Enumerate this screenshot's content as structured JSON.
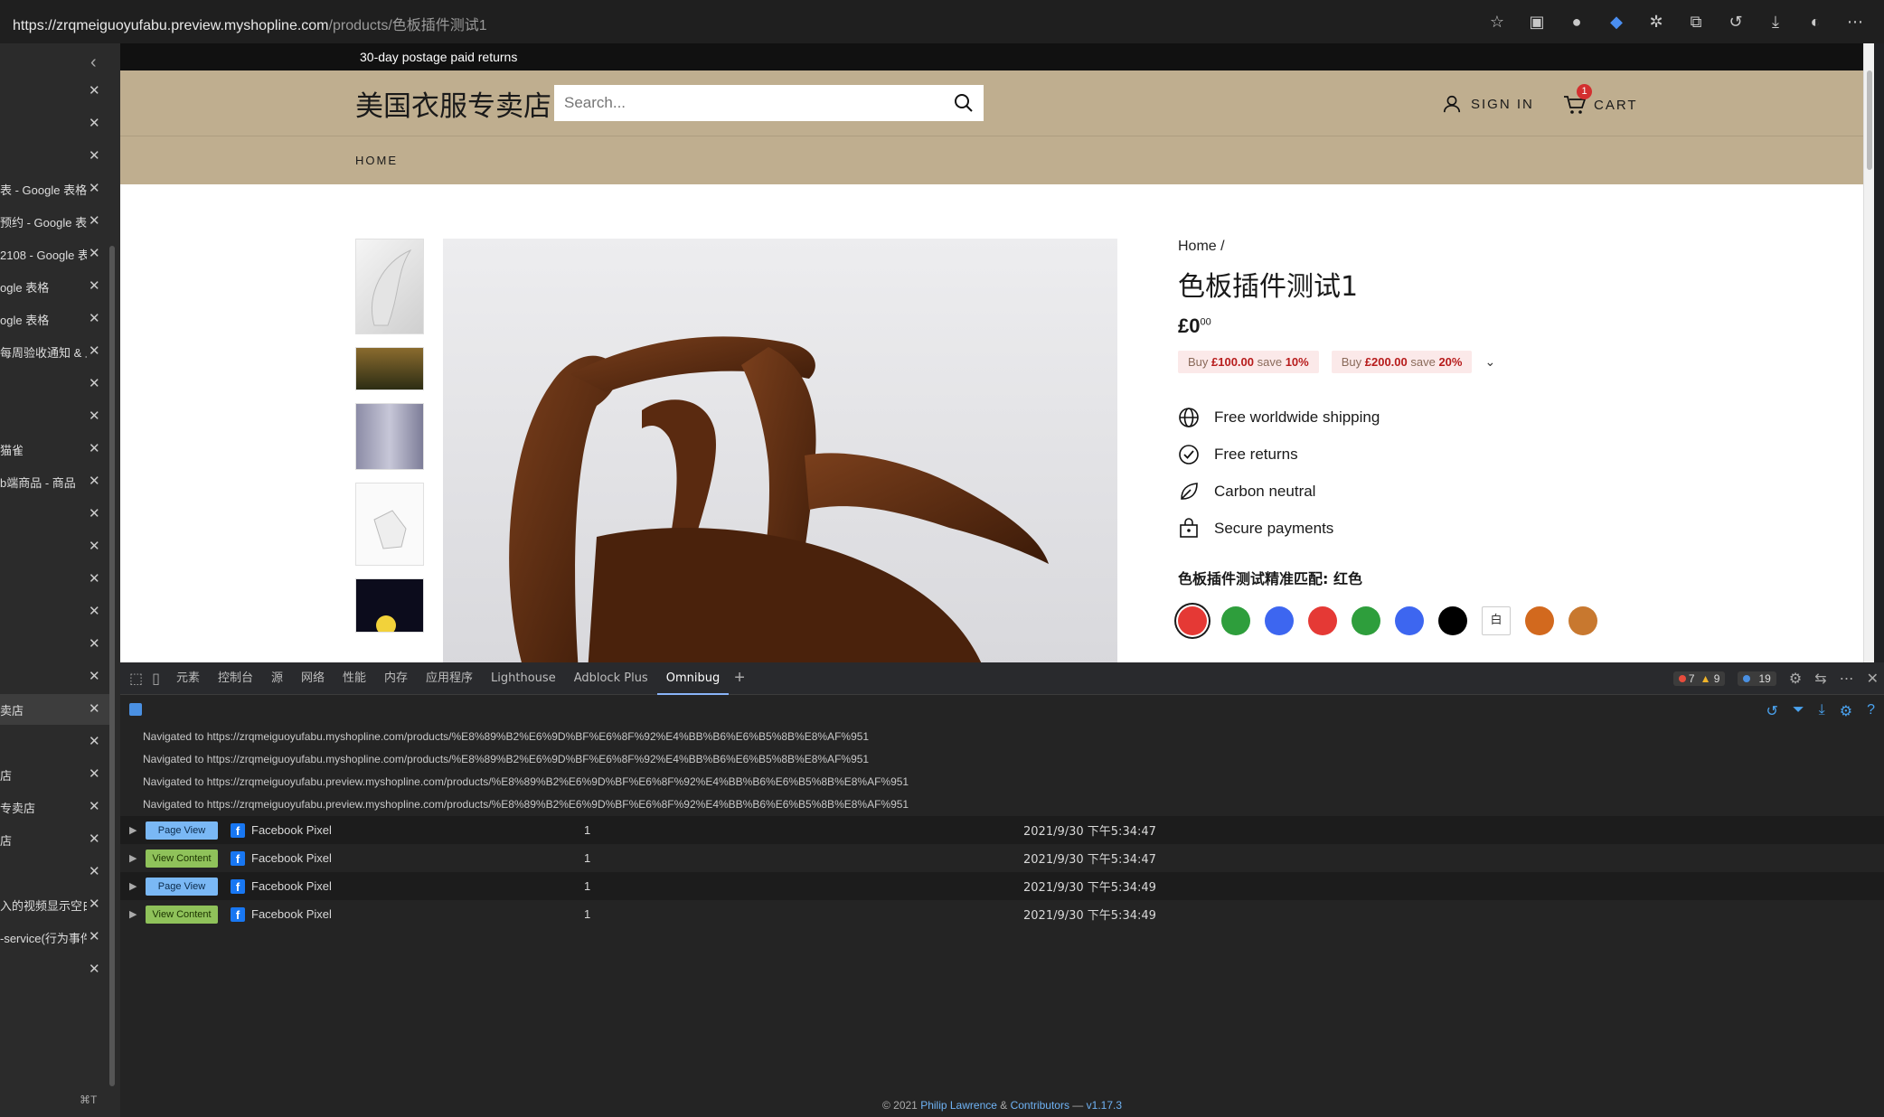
{
  "browser": {
    "url_host": "https://zrqmeiguoyufabu.preview.myshopline.com",
    "url_path": "/products/色板插件测试1"
  },
  "sidebar": {
    "tabs": [
      {
        "label": "",
        "active": false
      },
      {
        "label": "",
        "active": false
      },
      {
        "label": "",
        "active": false
      },
      {
        "label": "表 - Google 表格",
        "active": false
      },
      {
        "label": "预约 - Google 表",
        "active": false
      },
      {
        "label": "2108 - Google 表",
        "active": false
      },
      {
        "label": "ogle 表格",
        "active": false
      },
      {
        "label": "ogle 表格",
        "active": false
      },
      {
        "label": "每周验收通知 & 上",
        "active": false
      },
      {
        "label": "",
        "active": false
      },
      {
        "label": "",
        "active": false
      },
      {
        "label": "猫雀",
        "active": false
      },
      {
        "label": "b端商品 - 商品",
        "active": false
      },
      {
        "label": "",
        "active": false
      },
      {
        "label": "",
        "active": false
      },
      {
        "label": "",
        "active": false
      },
      {
        "label": "",
        "active": false
      },
      {
        "label": "",
        "active": false
      },
      {
        "label": "",
        "active": false
      },
      {
        "label": "卖店",
        "active": true
      },
      {
        "label": "",
        "active": false
      },
      {
        "label": "店",
        "active": false
      },
      {
        "label": "专卖店",
        "active": false
      },
      {
        "label": "店",
        "active": false
      },
      {
        "label": "",
        "active": false
      },
      {
        "label": "入的视频显示空白",
        "active": false
      },
      {
        "label": "-service(行为事件",
        "active": false
      },
      {
        "label": "",
        "active": false
      }
    ],
    "shortcut": "⌘T"
  },
  "site": {
    "announcement": "30-day postage paid returns",
    "logo": "美国衣服专卖店",
    "search_placeholder": "Search...",
    "sign_in": "SIGN IN",
    "cart": "CART",
    "cart_count": "1",
    "nav_home": "HOME",
    "breadcrumb": "Home /",
    "product_title": "色板插件测试1",
    "price_main": "£0",
    "price_cents": "00",
    "offers": [
      {
        "pre": "Buy ",
        "amount": "£100.00",
        "mid": " save ",
        "pct": "10%"
      },
      {
        "pre": "Buy ",
        "amount": "£200.00",
        "mid": " save ",
        "pct": "20%"
      }
    ],
    "perks": [
      {
        "icon": "globe-icon",
        "label": "Free worldwide shipping"
      },
      {
        "icon": "check-circle-icon",
        "label": "Free returns"
      },
      {
        "icon": "leaf-icon",
        "label": "Carbon neutral"
      },
      {
        "icon": "lock-bag-icon",
        "label": "Secure payments"
      }
    ],
    "variant_label": "色板插件测试精准匹配: 红色",
    "swatches": [
      {
        "color": "#e53935",
        "text": ""
      },
      {
        "color": "#2e9e3c",
        "text": ""
      },
      {
        "color": "#3d66f0",
        "text": ""
      },
      {
        "color": "#e53935",
        "text": ""
      },
      {
        "color": "#2e9e3c",
        "text": ""
      },
      {
        "color": "#3d66f0",
        "text": ""
      },
      {
        "color": "#000000",
        "text": ""
      },
      {
        "color": "#ffffff",
        "text": "白"
      },
      {
        "color": "#d2691e",
        "text": ""
      },
      {
        "color": "#c8782f",
        "text": ""
      }
    ]
  },
  "devtools": {
    "tabs": [
      "元素",
      "控制台",
      "源",
      "网络",
      "性能",
      "内存",
      "应用程序",
      "Lighthouse",
      "Adblock Plus",
      "Omnibug"
    ],
    "active_tab": "Omnibug",
    "errors": "7",
    "warnings": "9",
    "info": "19",
    "nav_lines": [
      "Navigated to https://zrqmeiguoyufabu.myshopline.com/products/%E8%89%B2%E6%9D%BF%E6%8F%92%E4%BB%B6%E6%B5%8B%E8%AF%951",
      "Navigated to https://zrqmeiguoyufabu.myshopline.com/products/%E8%89%B2%E6%9D%BF%E6%8F%92%E4%BB%B6%E6%B5%8B%E8%AF%951",
      "Navigated to https://zrqmeiguoyufabu.preview.myshopline.com/products/%E8%89%B2%E6%9D%BF%E6%8F%92%E4%BB%B6%E6%B5%8B%E8%AF%951",
      "Navigated to https://zrqmeiguoyufabu.preview.myshopline.com/products/%E8%89%B2%E6%9D%BF%E6%8F%92%E4%BB%B6%E6%B5%8B%E8%AF%951"
    ],
    "events": [
      {
        "type": "Page View",
        "kind": "pv",
        "account": "Facebook Pixel",
        "count": "1",
        "time": "2021/9/30 下午5:34:47"
      },
      {
        "type": "View Content",
        "kind": "vc",
        "account": "Facebook Pixel",
        "count": "1",
        "time": "2021/9/30 下午5:34:47"
      },
      {
        "type": "Page View",
        "kind": "pv",
        "account": "Facebook Pixel",
        "count": "1",
        "time": "2021/9/30 下午5:34:49"
      },
      {
        "type": "View Content",
        "kind": "vc",
        "account": "Facebook Pixel",
        "count": "1",
        "time": "2021/9/30 下午5:34:49"
      }
    ],
    "footer": {
      "prefix": "© 2021 ",
      "author": "Philip Lawrence",
      "amp": " & ",
      "contrib": "Contributors",
      "dash": " — ",
      "version": "v1.17.3"
    }
  }
}
